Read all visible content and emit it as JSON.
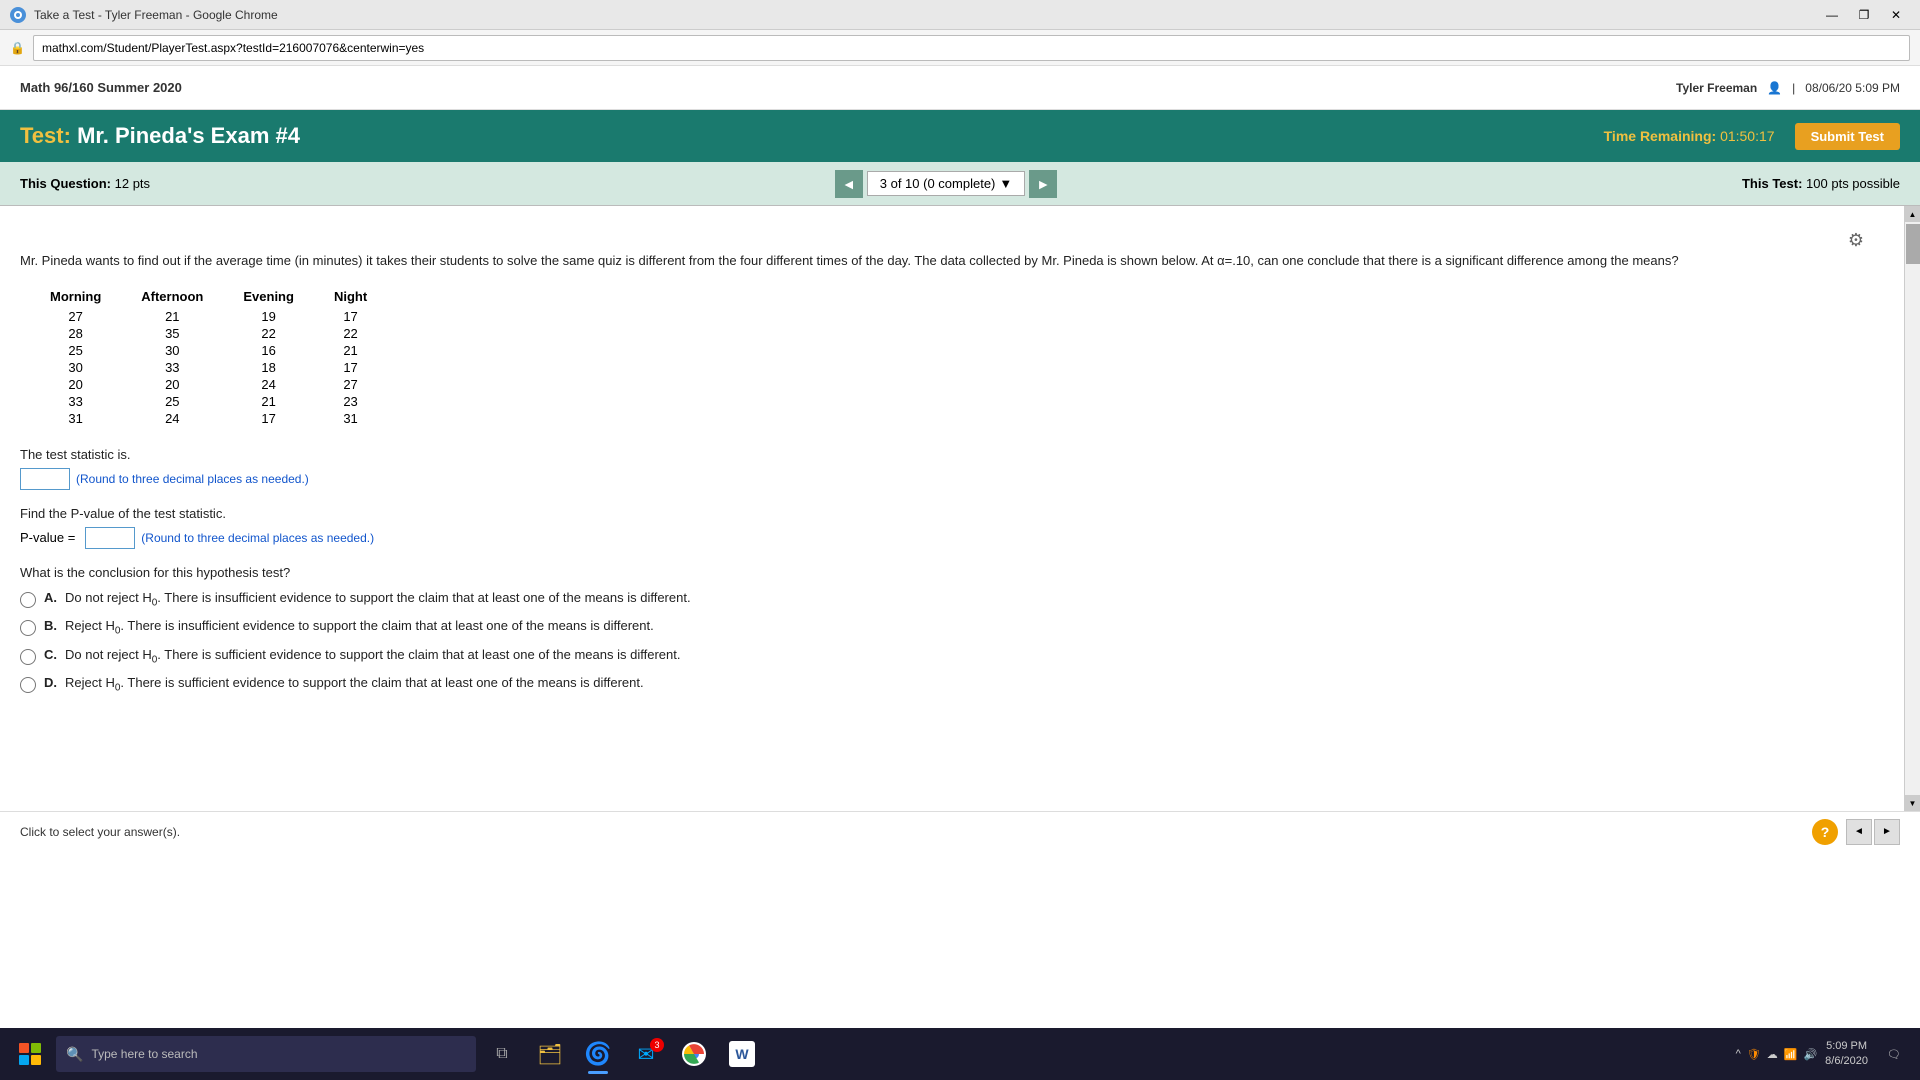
{
  "titlebar": {
    "title": "Take a Test - Tyler Freeman - Google Chrome",
    "minimize": "—",
    "maximize": "❐",
    "close": "✕"
  },
  "addressbar": {
    "url": "mathxl.com/Student/PlayerTest.aspx?testId=216007076&centerwin=yes",
    "lock": "🔒"
  },
  "appheader": {
    "course": "Math 96/160 Summer 2020",
    "user": "Tyler Freeman",
    "datetime": "08/06/20 5:09 PM",
    "separator": "|"
  },
  "testheader": {
    "test_label": "Test:",
    "test_name": "Mr. Pineda's Exam #4",
    "time_label": "Time Remaining:",
    "time_value": "01:50:17",
    "submit_label": "Submit Test"
  },
  "questionnav": {
    "this_question_label": "This Question:",
    "points": "12 pts",
    "nav_progress": "3 of 10 (0 complete)",
    "this_test_label": "This Test:",
    "test_points": "100 pts possible"
  },
  "question": {
    "text": "Mr. Pineda wants to find out if the average time (in minutes) it takes their students to solve the same quiz is different from the four different times of the day. The data collected by Mr. Pineda is shown below. At α=.10, can one conclude that there is a significant difference among the means?",
    "table": {
      "headers": [
        "Morning",
        "Afternoon",
        "Evening",
        "Night"
      ],
      "rows": [
        [
          27,
          21,
          19,
          17
        ],
        [
          28,
          35,
          22,
          22
        ],
        [
          25,
          30,
          16,
          21
        ],
        [
          30,
          33,
          18,
          17
        ],
        [
          20,
          20,
          24,
          27
        ],
        [
          33,
          25,
          21,
          23
        ],
        [
          31,
          24,
          17,
          31
        ]
      ]
    },
    "statistic_label": "The test statistic is.",
    "statistic_hint": "(Round to three decimal places as needed.)",
    "pvalue_label": "Find the P-value of the test statistic.",
    "pvalue_prefix": "P-value =",
    "pvalue_hint": "(Round to three decimal places as needed.)",
    "conclusion_label": "What is the conclusion for this hypothesis test?",
    "options": [
      {
        "key": "A",
        "text": "Do not reject H0. There is insufficient evidence to support the claim that at least one of the means is different."
      },
      {
        "key": "B",
        "text": "Reject H0. There is insufficient evidence to support the claim that at least one of the means is different."
      },
      {
        "key": "C",
        "text": "Do not reject H0. There is sufficient evidence to support the claim that at least one of the means is different."
      },
      {
        "key": "D",
        "text": "Reject H0. There is sufficient evidence to support the claim that at least one of the means is different."
      }
    ]
  },
  "bottombar": {
    "click_hint": "Click to select your answer(s).",
    "help": "?"
  },
  "taskbar": {
    "search_placeholder": "Type here to search",
    "time": "5:09 PM",
    "date": "8/6/2020"
  }
}
